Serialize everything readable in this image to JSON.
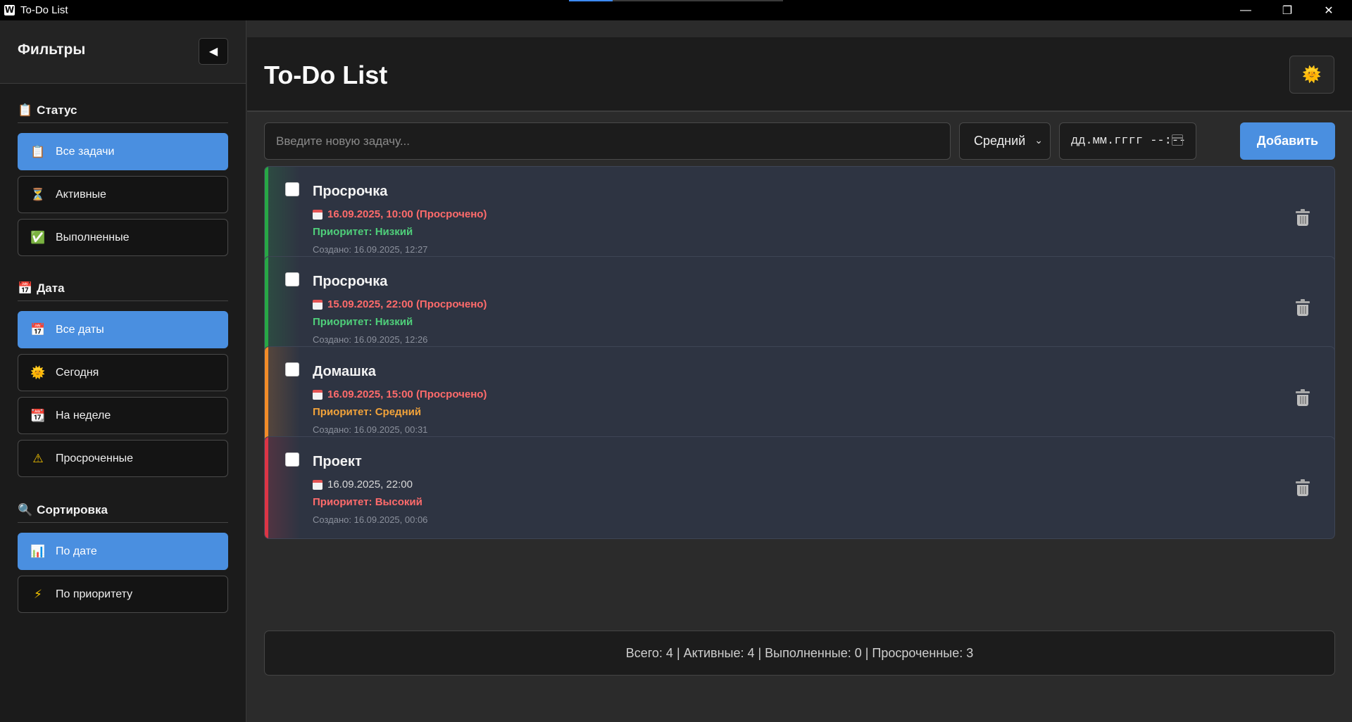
{
  "window": {
    "title": "To-Do List",
    "app_icon": "W",
    "buttons": {
      "minimize": "—",
      "maximize": "❐",
      "close": "✕"
    }
  },
  "sidebar": {
    "title": "Фильтры",
    "collapse_icon": "◀",
    "sections": {
      "status": {
        "icon": "📋",
        "title": "Статус"
      },
      "date": {
        "icon": "📅",
        "title": "Дата"
      },
      "sort": {
        "icon": "🔍",
        "title": "Сортировка"
      }
    },
    "status_items": [
      {
        "icon": "📋",
        "label": "Все задачи",
        "active": true
      },
      {
        "icon": "⏳",
        "label": "Активные",
        "active": false
      },
      {
        "icon": "✅",
        "label": "Выполненные",
        "active": false
      }
    ],
    "date_items": [
      {
        "icon": "📅",
        "label": "Все даты",
        "active": true
      },
      {
        "icon": "🌞",
        "label": "Сегодня",
        "active": false
      },
      {
        "icon": "📆",
        "label": "На неделе",
        "active": false
      },
      {
        "icon": "⚠",
        "label": "Просроченные",
        "active": false
      }
    ],
    "sort_items": [
      {
        "icon": "📊",
        "label": "По дате",
        "active": true
      },
      {
        "icon": "⚡",
        "label": "По приоритету",
        "active": false
      }
    ]
  },
  "header": {
    "title": "To-Do List",
    "theme_icon": "🌞"
  },
  "form": {
    "task_placeholder": "Введите новую задачу...",
    "task_value": "",
    "priority_selected": "Средний",
    "date_placeholder": "дд.мм.гггг --:--",
    "add_label": "Добавить"
  },
  "tasks": [
    {
      "title": "Просрочка",
      "due": "16.09.2025, 10:00 (Просрочено)",
      "overdue": true,
      "priority": "Приоритет: Низкий",
      "priority_level": "low",
      "created": "Создано: 16.09.2025, 12:27",
      "stripe_color": "#28a745"
    },
    {
      "title": "Просрочка",
      "due": "15.09.2025, 22:00 (Просрочено)",
      "overdue": true,
      "priority": "Приоритет: Низкий",
      "priority_level": "low",
      "created": "Создано: 16.09.2025, 12:26",
      "stripe_color": "#28a745"
    },
    {
      "title": "Домашка",
      "due": "16.09.2025, 15:00 (Просрочено)",
      "overdue": true,
      "priority": "Приоритет: Средний",
      "priority_level": "mid",
      "created": "Создано: 16.09.2025, 00:31",
      "stripe_color": "#f28c28"
    },
    {
      "title": "Проект",
      "due": "16.09.2025, 22:00",
      "overdue": false,
      "priority": "Приоритет: Высокий",
      "priority_level": "high",
      "created": "Создано: 16.09.2025, 00:06",
      "stripe_color": "#dc3545"
    }
  ],
  "stats": {
    "text": "Всего: 4 | Активные: 4 | Выполненные: 0 | Просроченные: 3"
  }
}
